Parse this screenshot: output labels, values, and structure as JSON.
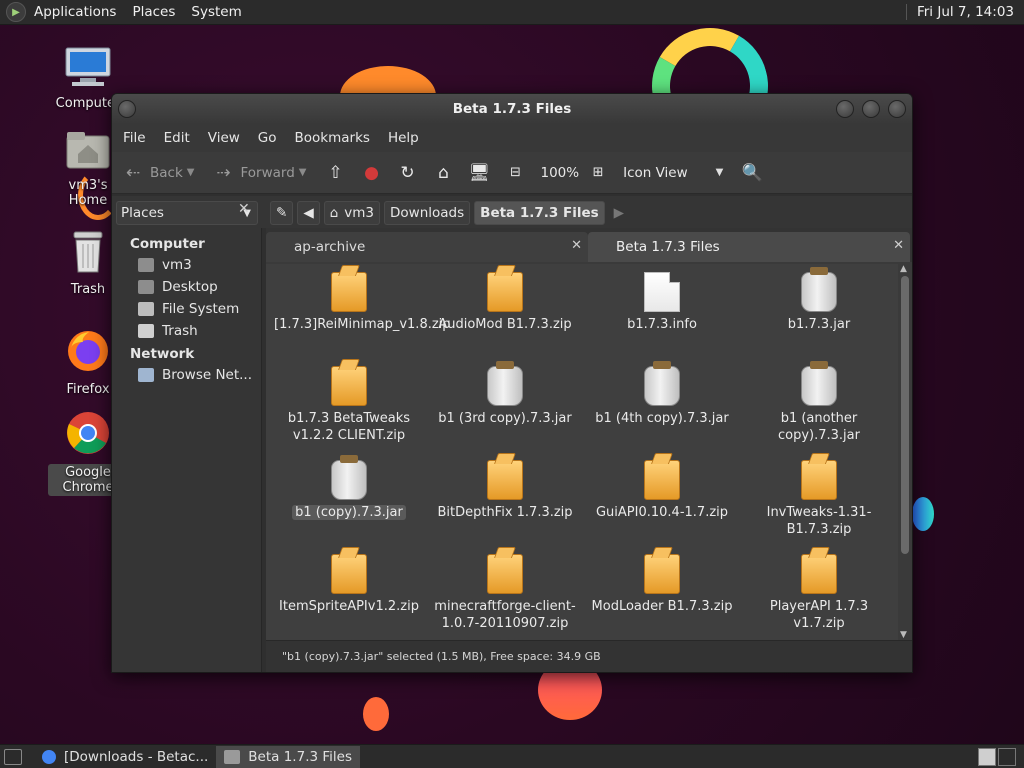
{
  "top_panel": {
    "menus": [
      "Applications",
      "Places",
      "System"
    ],
    "clock": "Fri Jul 7, 14:03"
  },
  "desktop_icons": [
    {
      "label": "Computer"
    },
    {
      "label": "vm3's Home"
    },
    {
      "label": "Trash"
    },
    {
      "label": "Firefox"
    },
    {
      "label": "Google Chrome"
    }
  ],
  "window": {
    "title": "Beta 1.7.3 Files",
    "menu": [
      "File",
      "Edit",
      "View",
      "Go",
      "Bookmarks",
      "Help"
    ],
    "toolbar": {
      "back": "Back",
      "forward": "Forward",
      "zoom": "100%",
      "view_mode": "Icon View"
    },
    "sidebar": {
      "selector": "Places",
      "sections": [
        {
          "title": "Computer",
          "items": [
            "vm3",
            "Desktop",
            "File System",
            "Trash"
          ]
        },
        {
          "title": "Network",
          "items": [
            "Browse Net..."
          ]
        }
      ]
    },
    "path": [
      "vm3",
      "Downloads",
      "Beta 1.7.3 Files"
    ],
    "tabs": [
      {
        "label": "ap-archive"
      },
      {
        "label": "Beta 1.7.3 Files"
      }
    ],
    "files": [
      {
        "name": "[1.7.3]ReiMinimap_v1.8.zip",
        "type": "zip"
      },
      {
        "name": "AudioMod B1.7.3.zip",
        "type": "zip"
      },
      {
        "name": "b1.7.3.info",
        "type": "doc"
      },
      {
        "name": "b1.7.3.jar",
        "type": "jar"
      },
      {
        "name": "b1.7.3 BetaTweaks v1.2.2 CLIENT.zip",
        "type": "zip"
      },
      {
        "name": "b1 (3rd copy).7.3.jar",
        "type": "jar"
      },
      {
        "name": "b1 (4th copy).7.3.jar",
        "type": "jar"
      },
      {
        "name": "b1 (another copy).7.3.jar",
        "type": "jar"
      },
      {
        "name": "b1 (copy).7.3.jar",
        "type": "jar",
        "selected": true
      },
      {
        "name": "BitDepthFix 1.7.3.zip",
        "type": "zip"
      },
      {
        "name": "GuiAPI0.10.4-1.7.zip",
        "type": "zip"
      },
      {
        "name": "InvTweaks-1.31-B1.7.3.zip",
        "type": "zip"
      },
      {
        "name": "ItemSpriteAPIv1.2.zip",
        "type": "zip"
      },
      {
        "name": "minecraftforge-client-1.0.7-20110907.zip",
        "type": "zip"
      },
      {
        "name": "ModLoader B1.7.3.zip",
        "type": "zip"
      },
      {
        "name": "PlayerAPI 1.7.3 v1.7.zip",
        "type": "zip"
      }
    ],
    "status": "\"b1 (copy).7.3.jar\" selected (1.5 MB), Free space: 34.9 GB"
  },
  "taskbar": {
    "tasks": [
      {
        "label": "[Downloads - Betac..."
      },
      {
        "label": "Beta 1.7.3 Files"
      }
    ]
  }
}
